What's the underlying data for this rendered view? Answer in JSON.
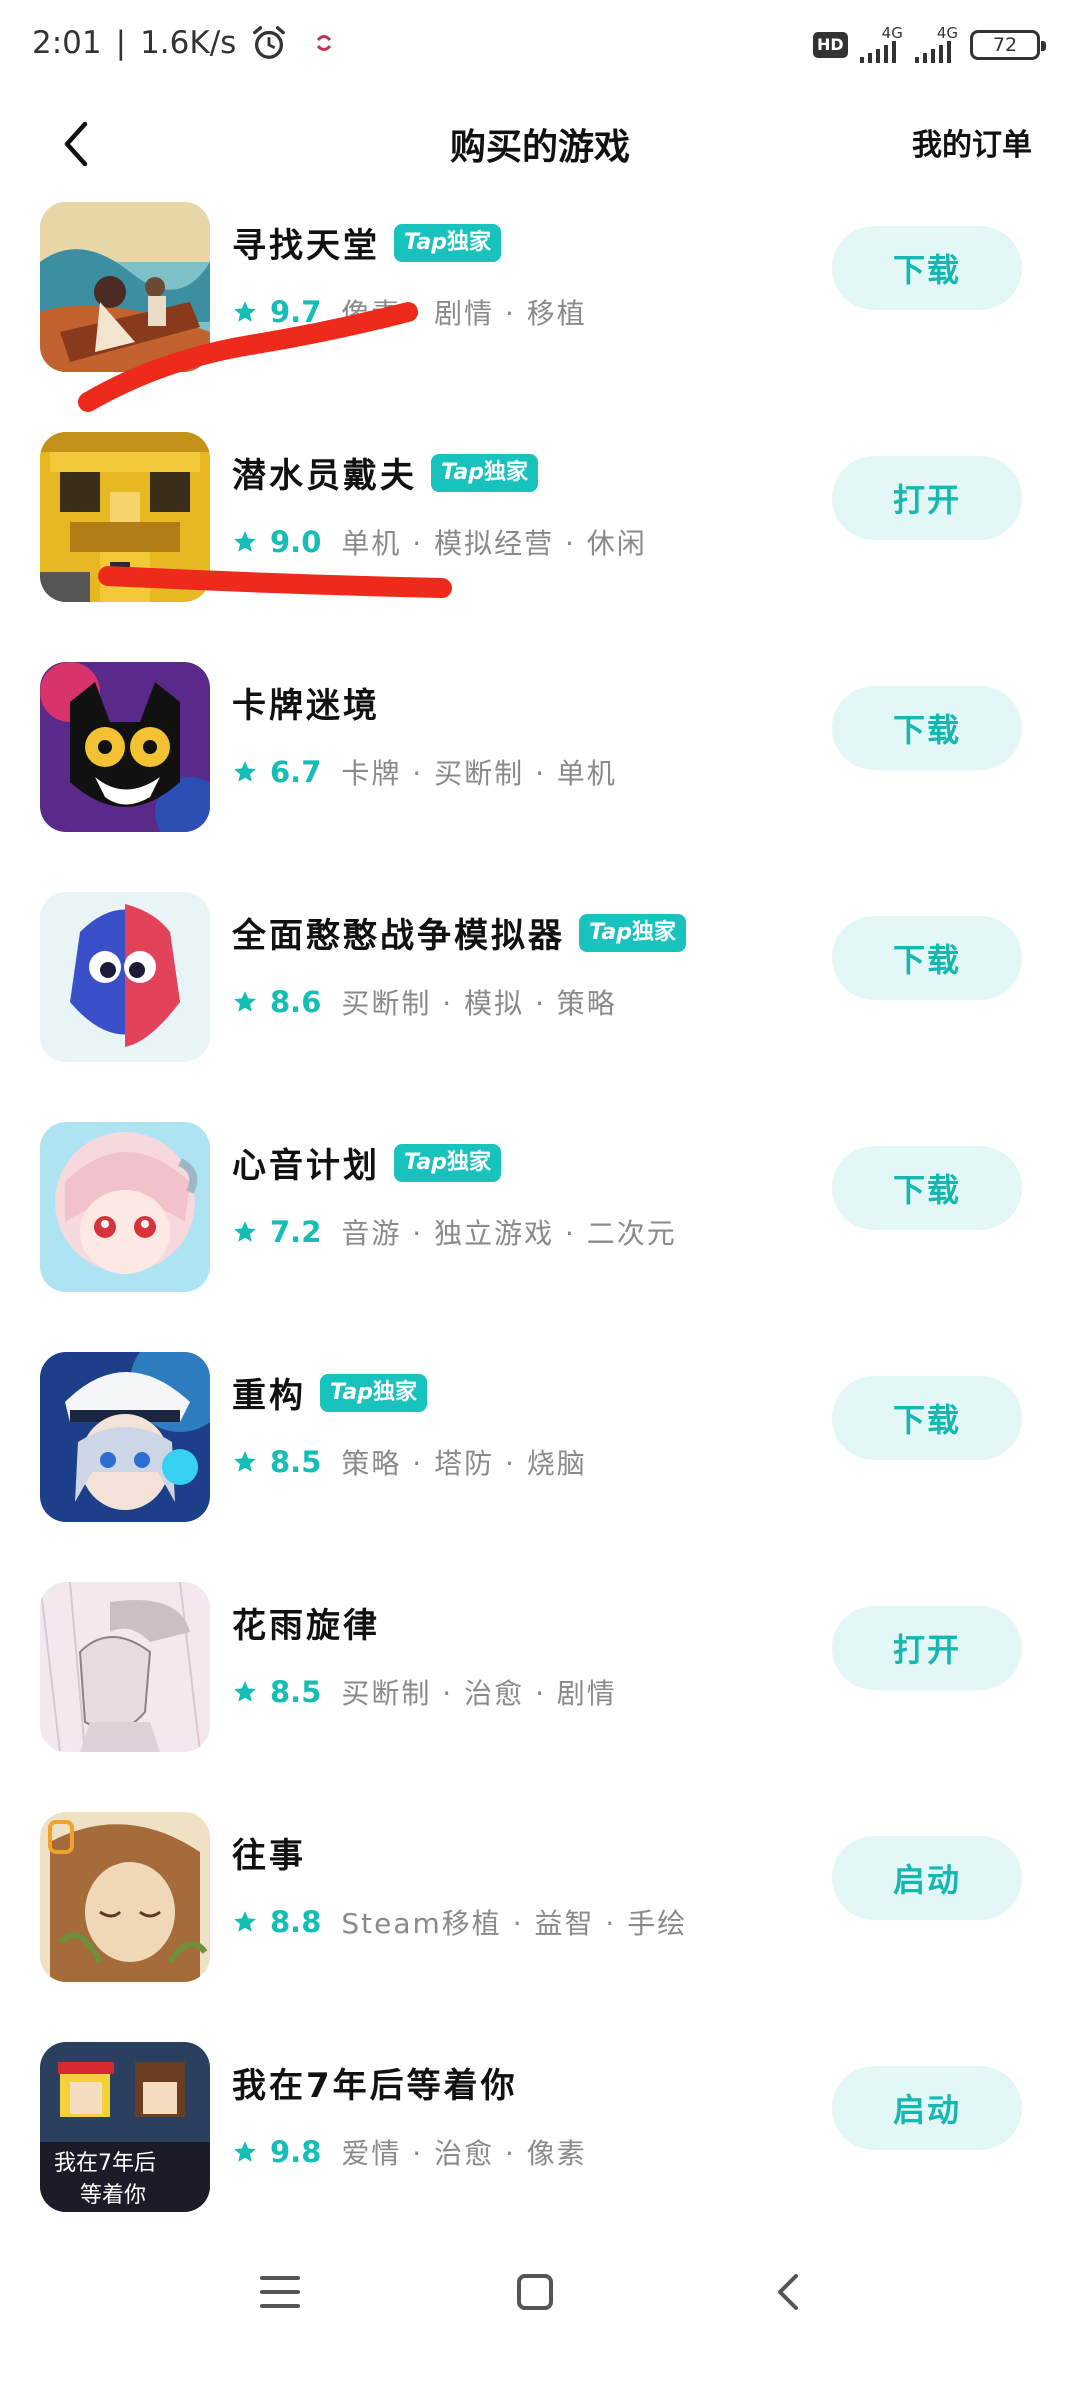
{
  "status_bar": {
    "time": "2:01",
    "separator": "|",
    "network_speed": "1.6K/s",
    "hd_label": "HD",
    "signal_1": "4G",
    "signal_2": "4G",
    "battery": "72"
  },
  "header": {
    "title": "购买的游戏",
    "orders_link": "我的订单"
  },
  "badge": {
    "tap": "Tap",
    "exclusive": "独家"
  },
  "games": [
    {
      "name": "寻找天堂",
      "tap_exclusive": true,
      "rating": "9.7",
      "tags": "像素 · 剧情 · 移植",
      "action": "下载"
    },
    {
      "name": "潜水员戴夫",
      "tap_exclusive": true,
      "rating": "9.0",
      "tags": "单机 · 模拟经营 · 休闲",
      "action": "打开"
    },
    {
      "name": "卡牌迷境",
      "tap_exclusive": false,
      "rating": "6.7",
      "tags": "卡牌 · 买断制 · 单机",
      "action": "下载"
    },
    {
      "name": "全面憨憨战争模拟器",
      "tap_exclusive": true,
      "rating": "8.6",
      "tags": "买断制 · 模拟 · 策略",
      "action": "下载"
    },
    {
      "name": "心音计划",
      "tap_exclusive": true,
      "rating": "7.2",
      "tags": "音游 · 独立游戏 · 二次元",
      "action": "下载"
    },
    {
      "name": "重构",
      "tap_exclusive": true,
      "rating": "8.5",
      "tags": "策略 · 塔防 · 烧脑",
      "action": "下载"
    },
    {
      "name": "花雨旋律",
      "tap_exclusive": false,
      "rating": "8.5",
      "tags": "买断制 · 治愈 · 剧情",
      "action": "打开"
    },
    {
      "name": "往事",
      "tap_exclusive": false,
      "rating": "8.8",
      "tags": "Steam移植 · 益智 · 手绘",
      "action": "启动"
    },
    {
      "name": "我在7年后等着你",
      "tap_exclusive": false,
      "rating": "9.8",
      "tags": "爱情 · 治愈 · 像素",
      "action": "启动"
    }
  ],
  "icon_text": {
    "wait7_line1": "我在7年后",
    "wait7_line2": "等着你"
  },
  "colors": {
    "accent": "#19c3bd",
    "button_bg": "#e3f7f6",
    "scribble": "#ee2a1b"
  }
}
